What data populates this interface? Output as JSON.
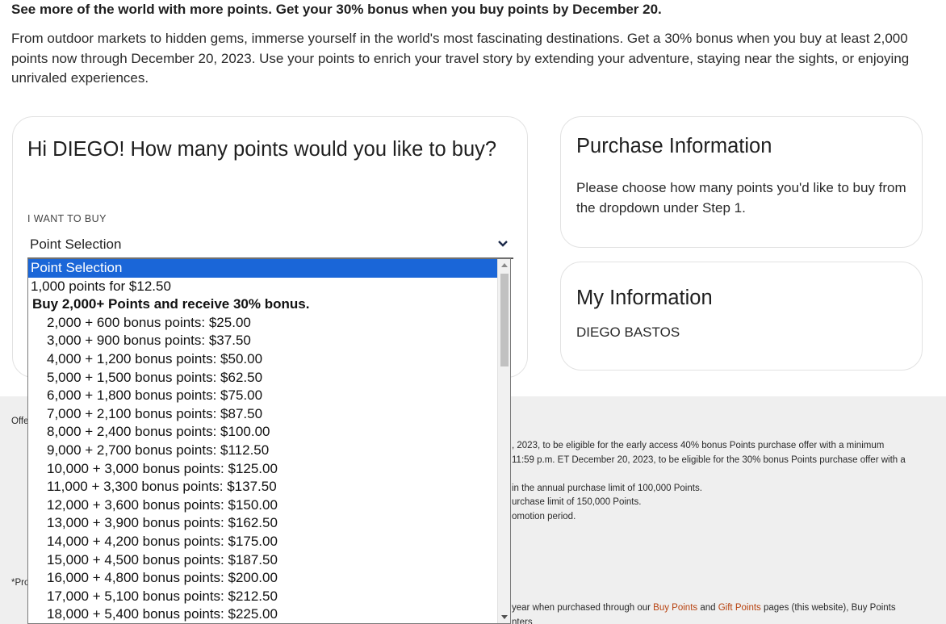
{
  "headline": "See more of the world with more points. Get your 30% bonus when you buy points by December 20.",
  "intro": "From outdoor markets to hidden gems, immerse yourself in the world's most fascinating destinations. Get a 30% bonus when you buy at least 2,000 points now through December 20, 2023. Use your points to enrich your travel story by extending your adventure, staying near the sights, or enjoying unrivaled experiences.",
  "buy_card": {
    "title": "Hi DIEGO! How many points would you like to buy?",
    "label": "I WANT TO BUY",
    "select_value": "Point Selection"
  },
  "purchase_card": {
    "title": "Purchase Information",
    "text": "Please choose how many points you'd like to buy from the dropdown under Step 1."
  },
  "myinfo_card": {
    "title": "My Information",
    "name": "DIEGO BASTOS"
  },
  "dropdown": {
    "selected": "Point Selection",
    "single": "1,000 points for $12.50",
    "group_label": "Buy 2,000+ Points and receive 30% bonus.",
    "options": [
      "2,000 + 600 bonus points: $25.00",
      "3,000 + 900 bonus points: $37.50",
      "4,000 + 1,200 bonus points: $50.00",
      "5,000 + 1,500 bonus points: $62.50",
      "6,000 + 1,800 bonus points: $75.00",
      "7,000 + 2,100 bonus points: $87.50",
      "8,000 + 2,400 bonus points: $100.00",
      "9,000 + 2,700 bonus points: $112.50",
      "10,000 + 3,000 bonus points: $125.00",
      "11,000 + 3,300 bonus points: $137.50",
      "12,000 + 3,600 bonus points: $150.00",
      "13,000 + 3,900 bonus points: $162.50",
      "14,000 + 4,200 bonus points: $175.00",
      "15,000 + 4,500 bonus points: $187.50",
      "16,000 + 4,800 bonus points: $200.00",
      "17,000 + 5,100 bonus points: $212.50",
      "18,000 + 5,400 bonus points: $225.00"
    ]
  },
  "footer": {
    "left_label_1": "Offe",
    "left_label_2": "*Pro",
    "r1": ", 2023, to be eligible for the early access 40% bonus Points purchase offer with a minimum",
    "r2": "11:59 p.m. ET December 20, 2023, to be eligible for the 30% bonus Points purchase offer with a",
    "r3": "in the annual purchase limit of 100,000 Points.",
    "r4": "urchase limit of 150,000 Points.",
    "r5": "omotion period.",
    "r6_pre": "year when purchased through our ",
    "r6_link1": "Buy Points",
    "r6_mid": " and ",
    "r6_link2": "Gift Points",
    "r6_post": " pages (this website), Buy Points",
    "r7": "nters"
  }
}
